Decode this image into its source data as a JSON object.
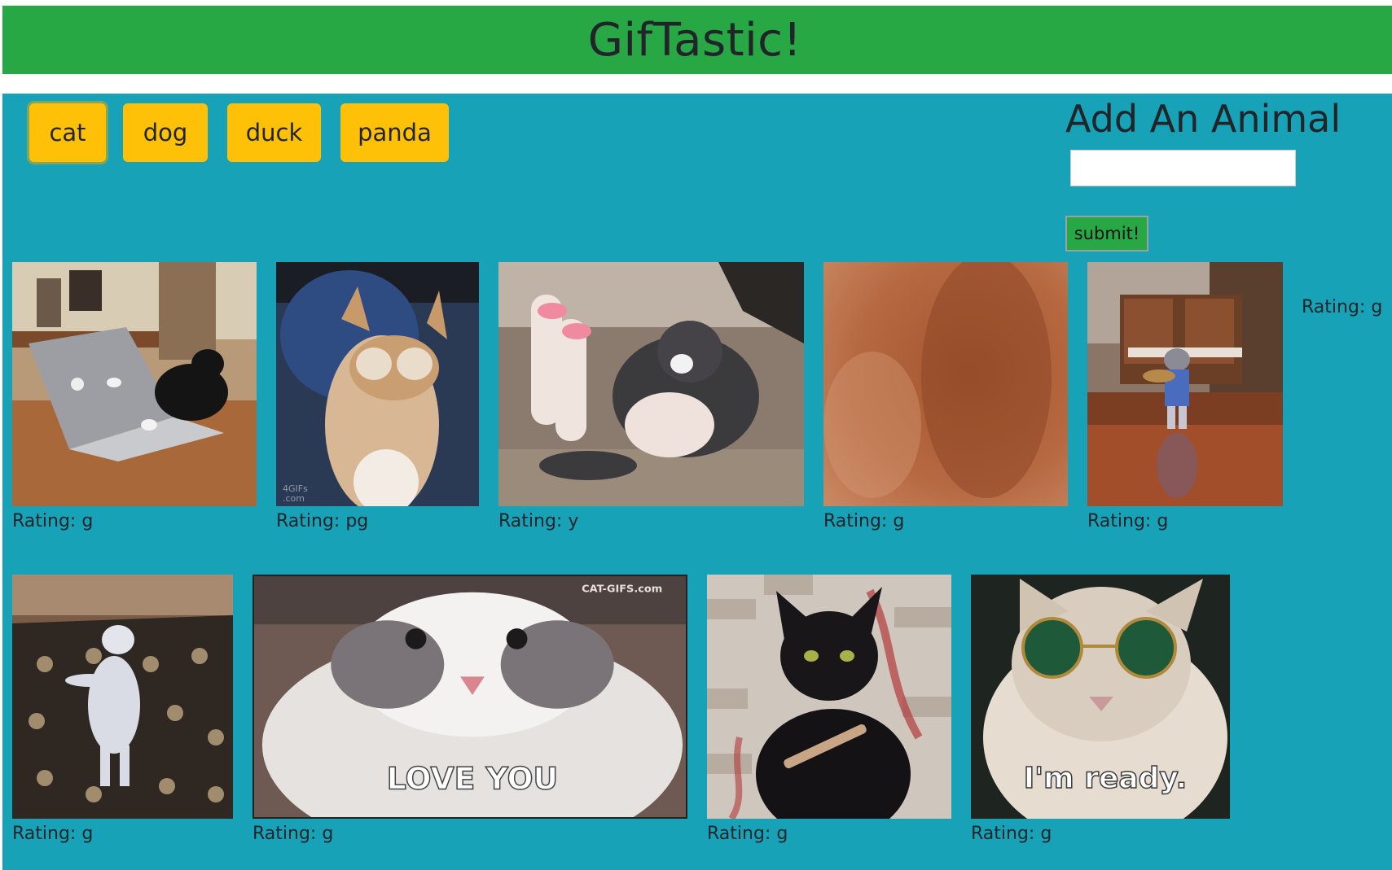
{
  "header": {
    "title": "GifTastic!"
  },
  "buttons": [
    "cat",
    "dog",
    "duck",
    "panda"
  ],
  "add_form": {
    "title": "Add An Animal",
    "input_value": "",
    "submit_label": "submit!"
  },
  "gifs": [
    {
      "rating": "Rating: g",
      "icon": "cat-typing-laptop-image"
    },
    {
      "rating": "Rating: pg",
      "icon": "cat-covering-eyes-image",
      "watermark": "4GIFs\n.com"
    },
    {
      "rating": "Rating: y",
      "icon": "kitten-stretching-image"
    },
    {
      "rating": "Rating: g",
      "icon": "blurry-cat-image"
    },
    {
      "rating": "Rating: g",
      "icon": "cat-playing-guitar-image"
    },
    {
      "rating": "Rating: g",
      "icon": "white-cat-dancing-on-rug-image"
    },
    {
      "rating": "Rating: g",
      "icon": "cat-love-you-image",
      "watermark": "CAT-GIFS.com",
      "caption": "LOVE YOU"
    },
    {
      "rating": "Rating: g",
      "icon": "black-cat-nail-file-image"
    },
    {
      "rating": "Rating: g",
      "icon": "cat-sunglasses-image",
      "caption": "I'm ready."
    }
  ],
  "side_rating": "Rating: g",
  "colors": {
    "header_bg": "#28a745",
    "main_bg": "#17a2b8",
    "button_bg": "#ffc107",
    "submit_bg": "#28a745"
  }
}
